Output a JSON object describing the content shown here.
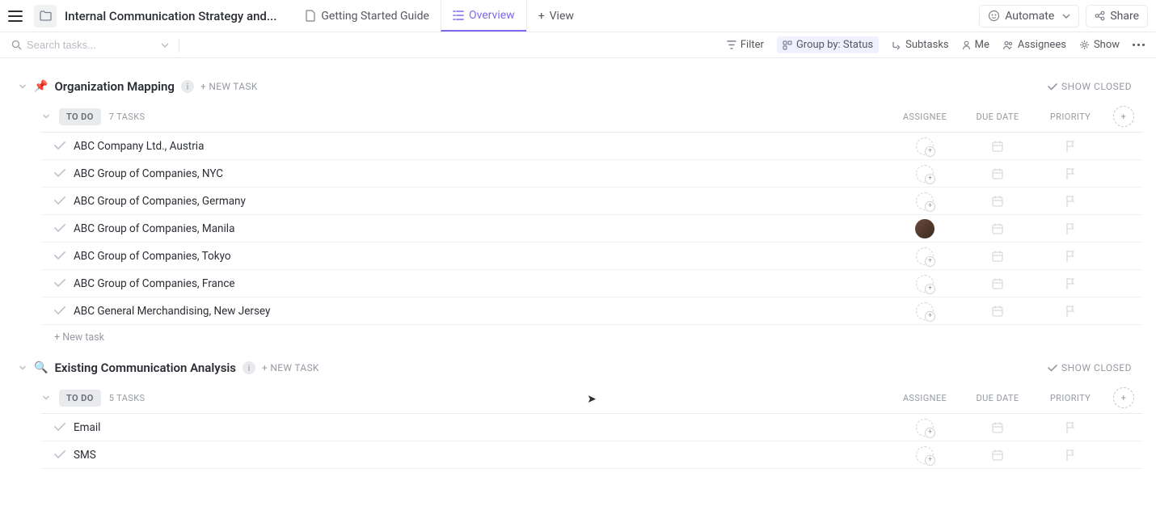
{
  "header": {
    "title": "Internal Communication Strategy and...",
    "tabs": [
      {
        "label": "Getting Started Guide",
        "icon": "doc-icon"
      },
      {
        "label": "Overview",
        "icon": "list-icon"
      },
      {
        "label": "View",
        "icon": "plus-icon"
      }
    ],
    "automate_label": "Automate",
    "share_label": "Share"
  },
  "toolbar": {
    "search_placeholder": "Search tasks...",
    "filter_label": "Filter",
    "groupby_label": "Group by: Status",
    "subtasks_label": "Subtasks",
    "me_label": "Me",
    "assignees_label": "Assignees",
    "show_label": "Show"
  },
  "common": {
    "new_task_upper": "+ NEW TASK",
    "show_closed": "SHOW CLOSED",
    "new_task_lower": "+ New task",
    "columns": {
      "assignee": "ASSIGNEE",
      "duedate": "DUE DATE",
      "priority": "PRIORITY"
    }
  },
  "sections": [
    {
      "icon": "📌",
      "title": "Organization Mapping",
      "status_label": "TO DO",
      "task_count_label": "7 TASKS",
      "tasks": [
        {
          "name": "ABC Company Ltd., Austria",
          "has_avatar": false
        },
        {
          "name": "ABC Group of Companies, NYC",
          "has_avatar": false
        },
        {
          "name": "ABC Group of Companies, Germany",
          "has_avatar": false
        },
        {
          "name": "ABC Group of Companies, Manila",
          "has_avatar": true
        },
        {
          "name": "ABC Group of Companies, Tokyo",
          "has_avatar": false
        },
        {
          "name": "ABC Group of Companies, France",
          "has_avatar": false
        },
        {
          "name": "ABC General Merchandising, New Jersey",
          "has_avatar": false
        }
      ]
    },
    {
      "icon": "🔍",
      "title": "Existing Communication Analysis",
      "status_label": "TO DO",
      "task_count_label": "5 TASKS",
      "tasks": [
        {
          "name": "Email",
          "has_avatar": false
        },
        {
          "name": "SMS",
          "has_avatar": false
        }
      ]
    }
  ]
}
